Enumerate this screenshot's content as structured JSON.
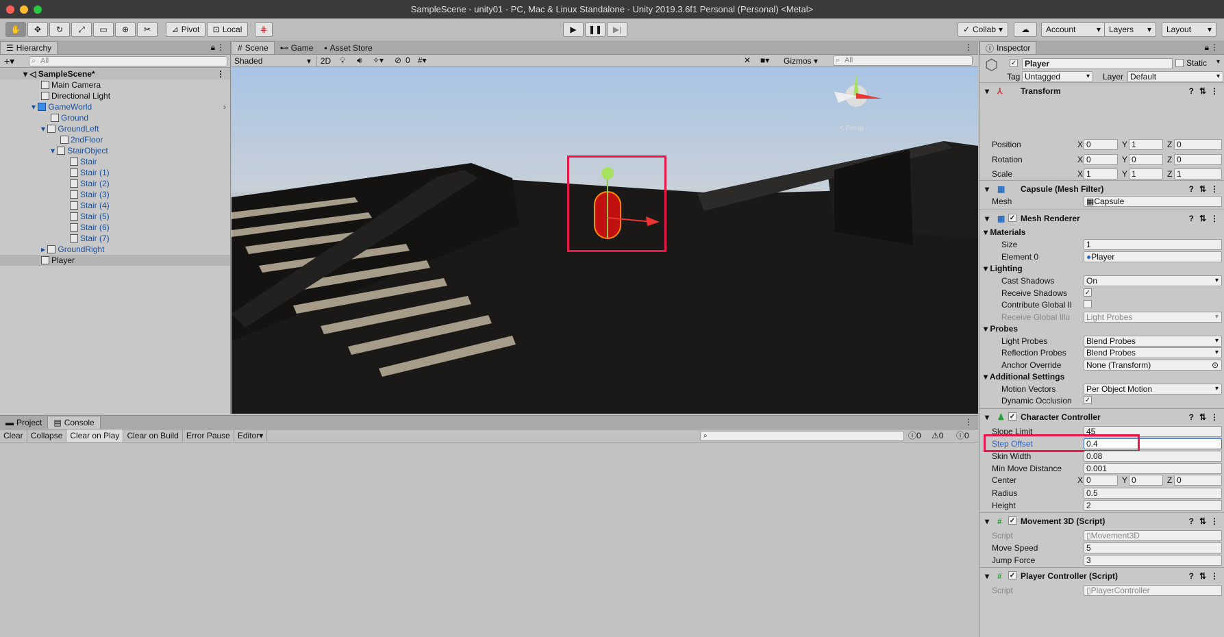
{
  "window": {
    "title": "SampleScene - unity01 - PC, Mac & Linux Standalone - Unity 2019.3.6f1 Personal (Personal) <Metal>"
  },
  "toolbar": {
    "pivot": "Pivot",
    "local": "Local",
    "collab": "Collab",
    "account": "Account",
    "layers": "Layers",
    "layout": "Layout"
  },
  "hierarchy": {
    "tab": "Hierarchy",
    "search_placeholder": "All",
    "items": [
      "SampleScene*",
      "Main Camera",
      "Directional Light",
      "GameWorld",
      "Ground",
      "GroundLeft",
      "2ndFloor",
      "StairObject",
      "Stair",
      "Stair (1)",
      "Stair (2)",
      "Stair (3)",
      "Stair (4)",
      "Stair (5)",
      "Stair (6)",
      "Stair (7)",
      "GroundRight",
      "Player"
    ]
  },
  "scene": {
    "tabs": [
      "Scene",
      "Game",
      "Asset Store"
    ],
    "shading": "Shaded",
    "mode2d": "2D",
    "hidden_count": "0",
    "gizmos": "Gizmos",
    "search_placeholder": "All",
    "view_label": "< Persp"
  },
  "console": {
    "tabs": [
      "Project",
      "Console"
    ],
    "buttons": [
      "Clear",
      "Collapse",
      "Clear on Play",
      "Clear on Build",
      "Error Pause",
      "Editor"
    ],
    "counts": [
      "0",
      "0",
      "0"
    ]
  },
  "inspector": {
    "tab": "Inspector",
    "object_name": "Player",
    "static_label": "Static",
    "tag_label": "Tag",
    "tag": "Untagged",
    "layer_label": "Layer",
    "layer": "Default",
    "transform": {
      "title": "Transform",
      "position_label": "Position",
      "rotation_label": "Rotation",
      "scale_label": "Scale",
      "position": [
        "0",
        "1",
        "0"
      ],
      "rotation": [
        "0",
        "0",
        "0"
      ],
      "scale": [
        "1",
        "1",
        "1"
      ]
    },
    "mesh_filter": {
      "title": "Capsule (Mesh Filter)",
      "mesh_label": "Mesh",
      "mesh": "Capsule"
    },
    "mesh_renderer": {
      "title": "Mesh Renderer",
      "materials": "Materials",
      "size_label": "Size",
      "size": "1",
      "element0_label": "Element 0",
      "element0": "Player",
      "lighting": "Lighting",
      "cast_shadows_label": "Cast Shadows",
      "cast_shadows": "On",
      "receive_shadows_label": "Receive Shadows",
      "contribute_gi_label": "Contribute Global Il",
      "receive_gi_label": "Receive Global Illu",
      "receive_gi": "Light Probes",
      "probes": "Probes",
      "light_probes_label": "Light Probes",
      "light_probes": "Blend Probes",
      "reflection_probes_label": "Reflection Probes",
      "reflection_probes": "Blend Probes",
      "anchor_label": "Anchor Override",
      "anchor": "None (Transform)",
      "additional": "Additional Settings",
      "motion_label": "Motion Vectors",
      "motion": "Per Object Motion",
      "dynamic_label": "Dynamic Occlusion"
    },
    "character_controller": {
      "title": "Character Controller",
      "slope_label": "Slope Limit",
      "slope": "45",
      "step_label": "Step Offset",
      "step": "0.4",
      "skin_label": "Skin Width",
      "skin": "0.08",
      "minmove_label": "Min Move Distance",
      "minmove": "0.001",
      "center_label": "Center",
      "center": [
        "0",
        "0",
        "0"
      ],
      "radius_label": "Radius",
      "radius": "0.5",
      "height_label": "Height",
      "height": "2"
    },
    "movement": {
      "title": "Movement 3D (Script)",
      "script_label": "Script",
      "script": "Movement3D",
      "speed_label": "Move Speed",
      "speed": "5",
      "jump_label": "Jump Force",
      "jump": "3"
    },
    "player_controller": {
      "title": "Player Controller (Script)",
      "script_label": "Script",
      "script": "PlayerController"
    },
    "axes": [
      "X",
      "Y",
      "Z"
    ]
  }
}
